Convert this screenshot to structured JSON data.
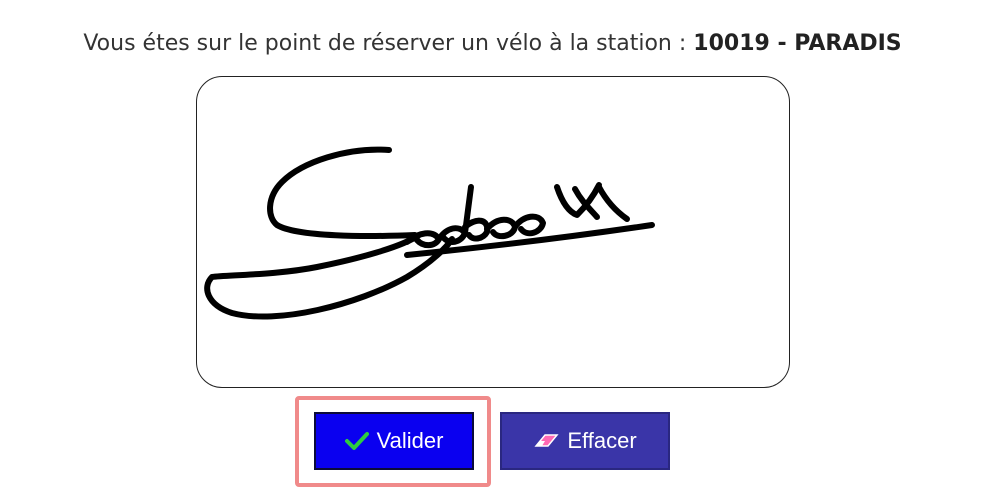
{
  "header": {
    "intro_text": "Vous étes sur le point de réserver un vélo à la station :",
    "station": "10019 - PARADIS"
  },
  "signature_pad": {
    "signature_text": "Sadeoy"
  },
  "actions": {
    "validate_label": "Valider",
    "validate_icon": "checkmark-icon",
    "clear_label": "Effacer",
    "clear_icon": "eraser-icon"
  },
  "colors": {
    "validate_button": "#0a00f0",
    "clear_button": "#3a35a8",
    "highlight": "#f08a8a",
    "checkmark": "#2ecc40",
    "eraser": "#ff69b4"
  }
}
